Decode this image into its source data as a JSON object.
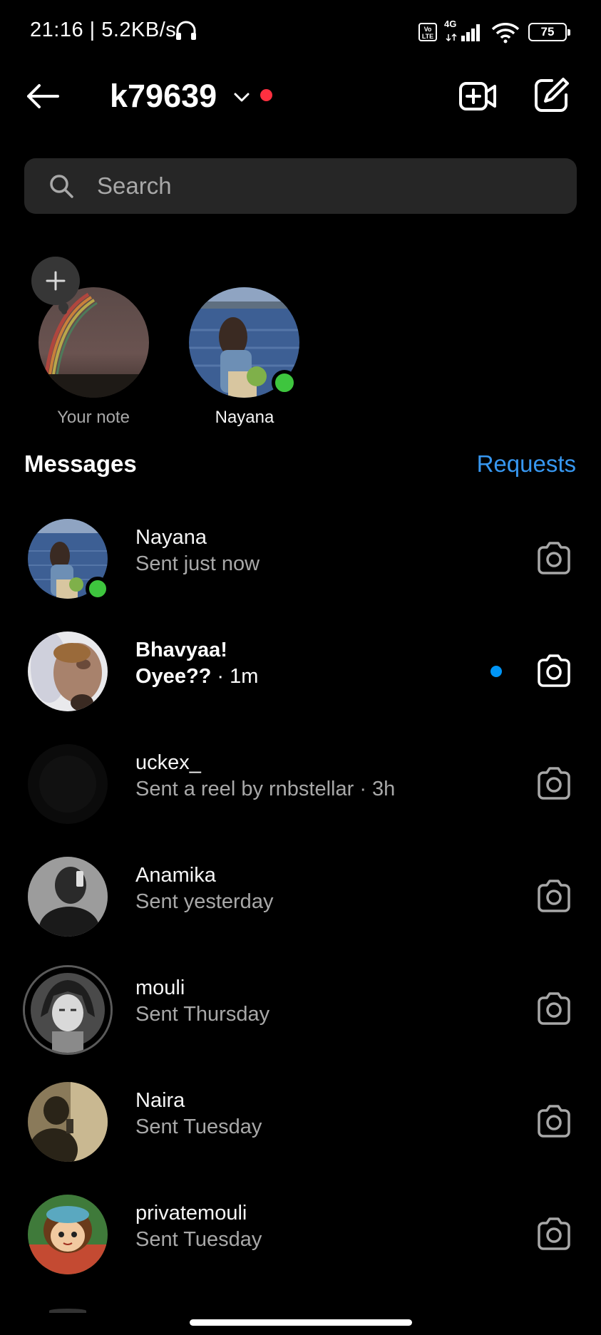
{
  "status_bar": {
    "time_speed": "21:16 | 5.2KB/s",
    "volte": "Vo LTE",
    "network": "4G",
    "battery": "75"
  },
  "header": {
    "account_name": "k79639",
    "dot_color": "#ff3040"
  },
  "search": {
    "placeholder": "Search"
  },
  "notes": [
    {
      "label": "Your note"
    },
    {
      "label": "Nayana"
    }
  ],
  "messages_section": {
    "title": "Messages",
    "requests_label": "Requests"
  },
  "threads": [
    {
      "name": "Nayana",
      "subtitle": "Sent just now",
      "meta": "",
      "unread": false,
      "online": true
    },
    {
      "name": "Bhavyaa!",
      "subtitle": "Oyee??",
      "meta": " · 1m",
      "unread": true,
      "online": false
    },
    {
      "name": "uckex_",
      "subtitle": "Sent a reel by rnbstellar · 3h",
      "meta": "",
      "unread": false,
      "online": false
    },
    {
      "name": "Anamika",
      "subtitle": "Sent yesterday",
      "meta": "",
      "unread": false,
      "online": false
    },
    {
      "name": "mouli",
      "subtitle": "Sent Thursday",
      "meta": "",
      "unread": false,
      "online": false
    },
    {
      "name": "Naira",
      "subtitle": "Sent Tuesday",
      "meta": "",
      "unread": false,
      "online": false
    },
    {
      "name": "privatemouli",
      "subtitle": "Sent Tuesday",
      "meta": "",
      "unread": false,
      "online": false
    }
  ],
  "colors": {
    "background": "#000000",
    "accent_blue": "#3797f0",
    "unread_dot": "#0095f6",
    "online_green": "#3ec53e",
    "search_bg": "#262626",
    "secondary_text": "#a8a8a8"
  },
  "icons": [
    "back-arrow-icon",
    "chevron-down-icon",
    "video-plus-icon",
    "compose-icon",
    "search-icon",
    "plus-icon",
    "camera-icon",
    "headset-icon",
    "signal-icon",
    "wifi-icon"
  ]
}
